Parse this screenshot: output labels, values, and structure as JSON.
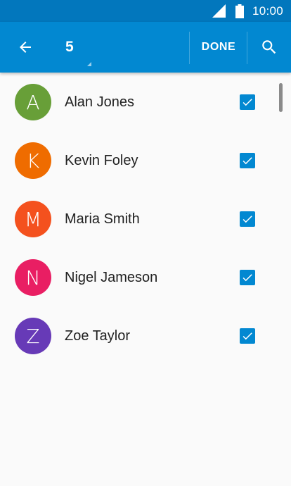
{
  "status_bar": {
    "time": "10:00",
    "icons": [
      "signal-icon",
      "battery-icon"
    ]
  },
  "app_bar": {
    "back_icon": "arrow-back-icon",
    "selected_count": "5",
    "done_label": "DONE",
    "search_icon": "search-icon"
  },
  "contacts": [
    {
      "initial": "A",
      "name": "Alan Jones",
      "color": "#689f38",
      "checked": true
    },
    {
      "initial": "K",
      "name": "Kevin Foley",
      "color": "#ef6c00",
      "checked": true
    },
    {
      "initial": "M",
      "name": "Maria Smith",
      "color": "#f4511e",
      "checked": true
    },
    {
      "initial": "N",
      "name": "Nigel Jameson",
      "color": "#e91e63",
      "checked": true
    },
    {
      "initial": "Z",
      "name": "Zoe Taylor",
      "color": "#673ab7",
      "checked": true
    }
  ],
  "colors": {
    "status_bar": "#0277bd",
    "app_bar": "#0288d1",
    "checkbox": "#0288d1",
    "background": "#fafafa"
  }
}
